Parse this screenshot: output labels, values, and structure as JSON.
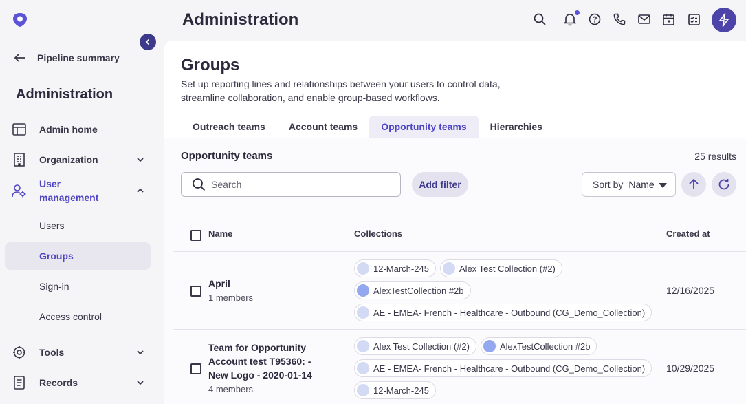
{
  "colors": {
    "accent": "#4e45c4",
    "brand": "#4c44a8",
    "active_bg": "#e8e6ef"
  },
  "sidebar": {
    "back_label": "Pipeline summary",
    "title": "Administration",
    "items": [
      {
        "label": "Admin home",
        "icon": "layout-icon"
      },
      {
        "label": "Organization",
        "icon": "building-icon"
      },
      {
        "label": "User management",
        "icon": "user-gear-icon"
      },
      {
        "label": "Tools",
        "icon": "tools-icon"
      },
      {
        "label": "Records",
        "icon": "records-icon"
      }
    ],
    "sub_items": [
      "Users",
      "Groups",
      "Sign-in",
      "Access control"
    ],
    "user_mgmt_line1": "User",
    "user_mgmt_line2": "management"
  },
  "header": {
    "title": "Administration",
    "icons": [
      "search-icon",
      "bell-icon",
      "help-icon",
      "phone-icon",
      "mail-icon",
      "calendar-icon",
      "tasks-icon",
      "bolt-icon"
    ]
  },
  "page": {
    "title": "Groups",
    "description": "Set up reporting lines and relationships between your users to control data, streamline collaboration, and enable group-based workflows.",
    "tabs": [
      "Outreach teams",
      "Account teams",
      "Opportunity teams",
      "Hierarchies"
    ],
    "active_tab": "Opportunity teams"
  },
  "list": {
    "title": "Opportunity teams",
    "results": "25 results",
    "search_placeholder": "Search",
    "add_filter": "Add filter",
    "sort_label": "Sort by",
    "sort_value": "Name",
    "columns": {
      "name": "Name",
      "collections": "Collections",
      "created": "Created at"
    },
    "rows": [
      {
        "name": "April",
        "members": "1 members",
        "created": "12/16/2025",
        "chip_lines": [
          [
            {
              "label": "12-March-245",
              "dark": false
            },
            {
              "label": "Alex Test Collection (#2)",
              "dark": false
            }
          ],
          [
            {
              "label": "AlexTestCollection #2b",
              "dark": true
            }
          ],
          [
            {
              "label": "AE - EMEA- French - Healthcare - Outbound (CG_Demo_Collection)",
              "dark": false
            }
          ]
        ]
      },
      {
        "name": "Team for Opportunity Account test T95360: - New Logo - 2020-01-14",
        "members": "4 members",
        "created": "10/29/2025",
        "chip_lines": [
          [
            {
              "label": "Alex Test Collection (#2)",
              "dark": false
            },
            {
              "label": "AlexTestCollection #2b",
              "dark": true
            }
          ],
          [
            {
              "label": "AE - EMEA- French - Healthcare - Outbound (CG_Demo_Collection)",
              "dark": false
            }
          ],
          [
            {
              "label": "12-March-245",
              "dark": false
            }
          ]
        ]
      }
    ]
  }
}
